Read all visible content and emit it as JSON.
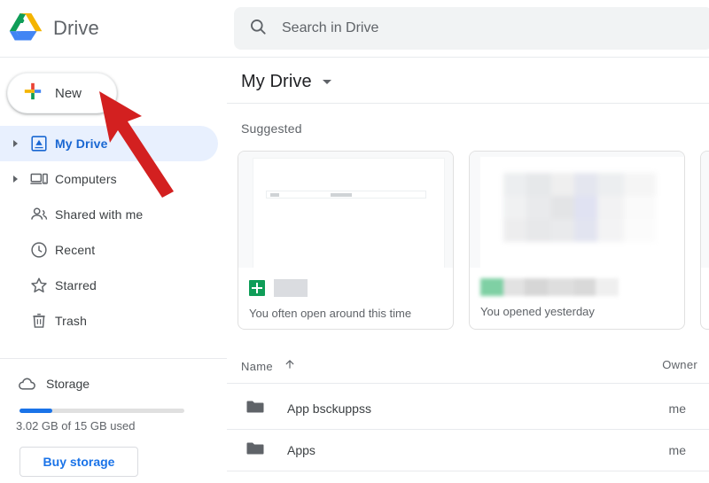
{
  "brand": {
    "name": "Drive",
    "logo_icon": "google-drive-logo-icon"
  },
  "new_button": {
    "label": "New",
    "icon": "plus-icon"
  },
  "search": {
    "placeholder": "Search in Drive",
    "value": "",
    "icon": "search-icon"
  },
  "sidebar": {
    "items": [
      {
        "label": "My Drive",
        "icon": "my-drive-icon",
        "expandable": true,
        "active": true
      },
      {
        "label": "Computers",
        "icon": "computers-icon",
        "expandable": true,
        "active": false
      },
      {
        "label": "Shared with me",
        "icon": "people-icon",
        "expandable": false,
        "active": false
      },
      {
        "label": "Recent",
        "icon": "clock-icon",
        "expandable": false,
        "active": false
      },
      {
        "label": "Starred",
        "icon": "star-icon",
        "expandable": false,
        "active": false
      },
      {
        "label": "Trash",
        "icon": "trash-icon",
        "expandable": false,
        "active": false
      }
    ],
    "storage": {
      "label": "Storage",
      "icon": "cloud-icon",
      "usage_text": "3.02 GB of 15 GB used",
      "used_percent": 20,
      "buy_label": "Buy storage"
    }
  },
  "main": {
    "title": "My Drive",
    "title_caret_icon": "chevron-down-icon",
    "suggested_label": "Suggested",
    "cards": [
      {
        "caption": "You often open around this time",
        "file_icon": "google-sheets-icon",
        "thumb": "document"
      },
      {
        "caption": "You opened yesterday",
        "file_icon": "google-sheets-icon",
        "thumb": "spreadsheet"
      },
      {
        "caption": "",
        "file_icon": "",
        "thumb": "blank"
      }
    ],
    "list": {
      "columns": {
        "name": "Name",
        "owner": "Owner"
      },
      "sort_icon": "arrow-up-icon",
      "rows": [
        {
          "name": "App bsckuppss",
          "owner": "me",
          "icon": "folder-icon"
        },
        {
          "name": "Apps",
          "owner": "me",
          "icon": "folder-icon"
        }
      ]
    }
  },
  "annotation": {
    "arrow_color": "#d32020",
    "points_to": "New"
  },
  "colors": {
    "accent_blue": "#1a73e8",
    "active_pill": "#e8f0fe",
    "active_text": "#1967d2",
    "text_primary": "#3c4043",
    "text_secondary": "#5f6368",
    "sheets_green": "#0f9d58",
    "search_bg": "#f1f3f4"
  }
}
